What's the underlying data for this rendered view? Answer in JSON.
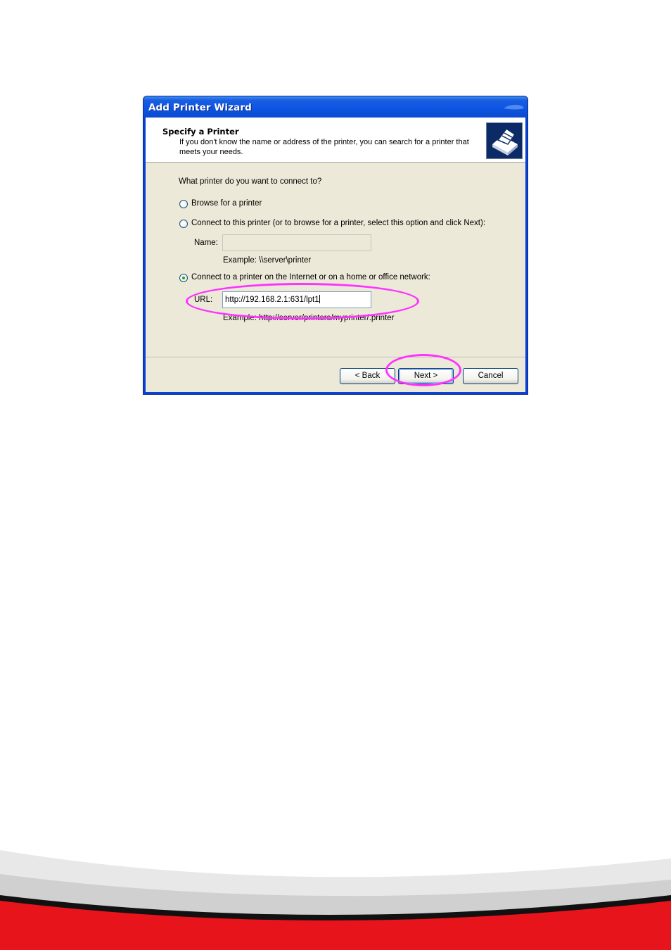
{
  "window": {
    "title": "Add Printer Wizard"
  },
  "header": {
    "title": "Specify a Printer",
    "subtitle": "If you don't know the name or address of the printer, you can search for a printer that meets your needs.",
    "icon": "printer-icon"
  },
  "body": {
    "question": "What printer do you want to connect to?",
    "options": [
      {
        "label": "Browse for a printer",
        "selected": false
      },
      {
        "label": "Connect to this printer (or to browse for a printer, select this option and click Next):",
        "selected": false
      },
      {
        "label": "Connect to a printer on the Internet or on a home or office network:",
        "selected": true
      }
    ],
    "name_field": {
      "label": "Name:",
      "value": "",
      "example": "Example: \\\\server\\printer"
    },
    "url_field": {
      "label": "URL:",
      "value": "http://192.168.2.1:631/lpt1",
      "example": "Example: http://server/printers/myprinter/.printer"
    }
  },
  "buttons": {
    "back": "< Back",
    "next": "Next >",
    "cancel": "Cancel"
  },
  "colors": {
    "titlebar": "#0a4bd0",
    "dialog_bg": "#ece9d8",
    "highlight": "#ff33ff",
    "footer_red": "#e8141c"
  }
}
